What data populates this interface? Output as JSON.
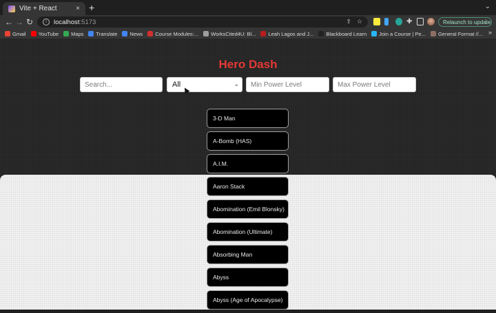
{
  "browser": {
    "tab_title": "Vite + React",
    "tab_close": "×",
    "new_tab": "+",
    "url_host": "localhost",
    "url_port": ":5173",
    "relaunch_label": "Relaunch to update",
    "bookmarks": [
      {
        "label": "Gmail",
        "color": "#ea4335"
      },
      {
        "label": "YouTube",
        "color": "#ff0000"
      },
      {
        "label": "Maps",
        "color": "#34a853"
      },
      {
        "label": "Translate",
        "color": "#4285f4"
      },
      {
        "label": "News",
        "color": "#4285f4"
      },
      {
        "label": "Course Modules:...",
        "color": "#d32f2f"
      },
      {
        "label": "WorksCited4U: Bl...",
        "color": "#9e9e9e"
      },
      {
        "label": "Leah Lagos and J...",
        "color": "#b71c1c"
      },
      {
        "label": "Blackboard Learn",
        "color": "#222222"
      },
      {
        "label": "Join a Course | Pe...",
        "color": "#29b6f6"
      },
      {
        "label": "General Format //...",
        "color": "#8d6e63"
      }
    ]
  },
  "app": {
    "title": "Hero Dash",
    "search_placeholder": "Search...",
    "filter_selected": "All",
    "min_power_placeholder": "Min Power Level",
    "max_power_placeholder": "Max Power Level",
    "heroes": [
      "3-D Man",
      "A-Bomb (HAS)",
      "A.I.M.",
      "Aaron Stack",
      "Abomination (Emil Blonsky)",
      "Abomination (Ultimate)",
      "Absorbing Man",
      "Abyss",
      "Abyss (Age of Apocalypse)"
    ]
  },
  "colors": {
    "title": "#e53935",
    "page_bg": "#242424",
    "hero_bg": "#000000"
  }
}
